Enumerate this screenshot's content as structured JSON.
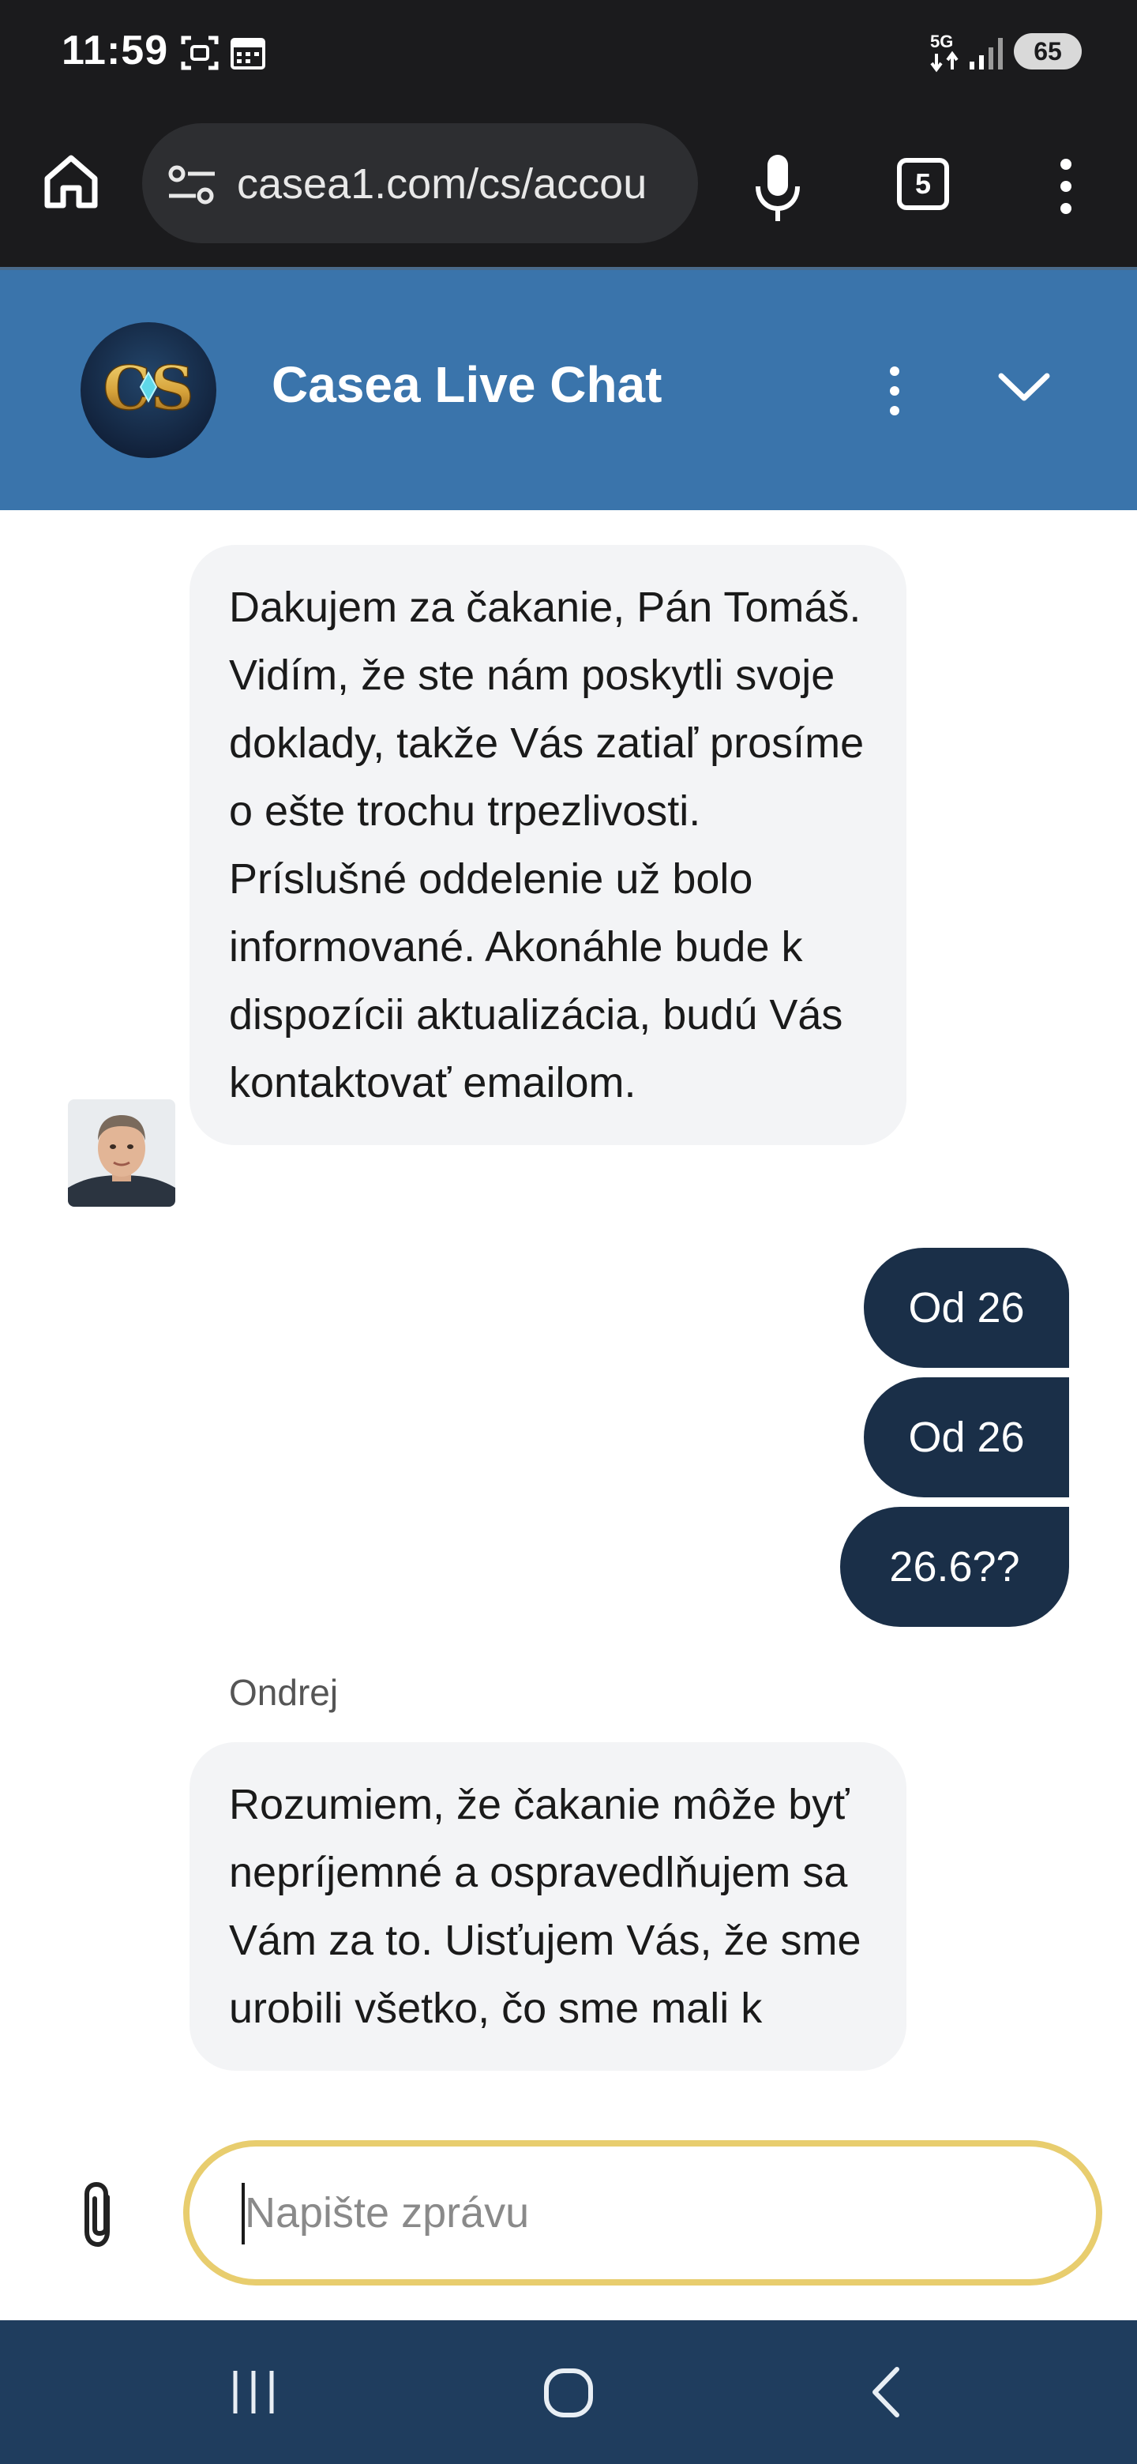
{
  "status_bar": {
    "time": "11:59",
    "network": "5G",
    "battery": "65"
  },
  "browser": {
    "url": "casea1.com/cs/accou",
    "tab_count": "5"
  },
  "chat_header": {
    "title": "Casea Live Chat",
    "logo_text": "CS"
  },
  "messages": [
    {
      "sender": "agent",
      "text": "Dakujem za čakanie, Pán Tomáš. Vidím, že ste nám poskytli svoje doklady, takže Vás zatiaľ prosíme o ešte trochu trpezlivosti. Príslušné oddelenie už bolo informované. Akonáhle bude k dispozícii aktualizácia, budú Vás kontaktovať emailom."
    },
    {
      "sender": "user",
      "text": "Od 26"
    },
    {
      "sender": "user",
      "text": "Od 26"
    },
    {
      "sender": "user",
      "text": "26.6??"
    },
    {
      "sender": "agent",
      "name": "Ondrej",
      "text": "Rozumiem, že čakanie môže byť nepríjemné a ospravedlňujem sa Vám za to. Uisťujem Vás, že sme urobili všetko, čo sme mali k"
    }
  ],
  "composer": {
    "placeholder": "Napište zprávu"
  },
  "colors": {
    "header": "#3a74ab",
    "user_bubble": "#1a2f48",
    "agent_bubble": "#f3f4f6",
    "input_border": "#e8cd6e",
    "nav_bar": "#1f3d5e"
  },
  "icons": {
    "browser": [
      "home-icon",
      "site-settings-icon",
      "microphone-icon",
      "tab-switcher-icon",
      "more-vert-icon"
    ],
    "chat": [
      "more-vert-icon",
      "chevron-down-icon",
      "paperclip-icon"
    ],
    "nav": [
      "recents-icon",
      "home-icon",
      "back-icon"
    ]
  }
}
